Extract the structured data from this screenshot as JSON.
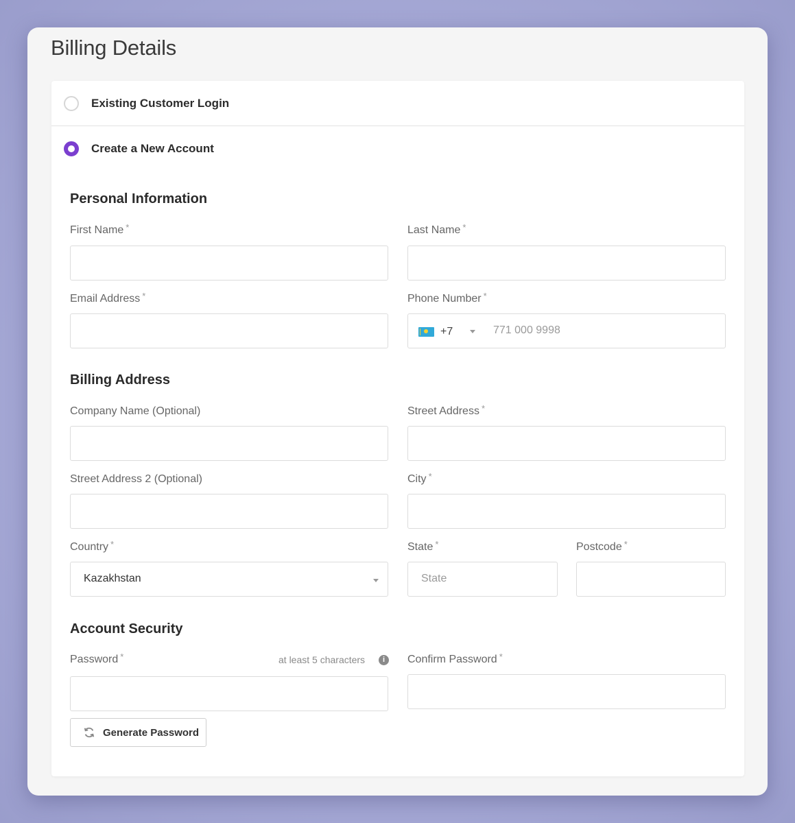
{
  "page": {
    "title": "Billing Details"
  },
  "options": [
    {
      "label": "Existing Customer Login",
      "checked": false
    },
    {
      "label": "Create a New Account",
      "checked": true
    }
  ],
  "sections": {
    "personal": "Personal Information",
    "billing": "Billing Address",
    "security": "Account Security"
  },
  "fields": {
    "first_name": {
      "label": "First Name",
      "required": "*",
      "value": ""
    },
    "last_name": {
      "label": "Last Name",
      "required": "*",
      "value": ""
    },
    "email": {
      "label": "Email Address",
      "required": "*",
      "value": ""
    },
    "phone": {
      "label": "Phone Number",
      "required": "*",
      "country_code": "+7",
      "placeholder": "771 000 9998",
      "flag": "kazakhstan-flag"
    },
    "company": {
      "label": "Company Name (Optional)",
      "value": ""
    },
    "street": {
      "label": "Street Address",
      "required": "*",
      "value": ""
    },
    "street2": {
      "label": "Street Address 2 (Optional)",
      "value": ""
    },
    "city": {
      "label": "City",
      "required": "*",
      "value": ""
    },
    "country": {
      "label": "Country",
      "required": "*",
      "value": "Kazakhstan"
    },
    "state": {
      "label": "State",
      "required": "*",
      "placeholder": "State"
    },
    "postcode": {
      "label": "Postcode",
      "required": "*",
      "value": ""
    },
    "password": {
      "label": "Password",
      "required": "*",
      "hint": "at least 5 characters",
      "value": ""
    },
    "confirm_password": {
      "label": "Confirm Password",
      "required": "*",
      "value": ""
    }
  },
  "buttons": {
    "generate_password": "Generate Password"
  },
  "colors": {
    "accent": "#7b3fcf",
    "background": "#a6a9d6"
  }
}
